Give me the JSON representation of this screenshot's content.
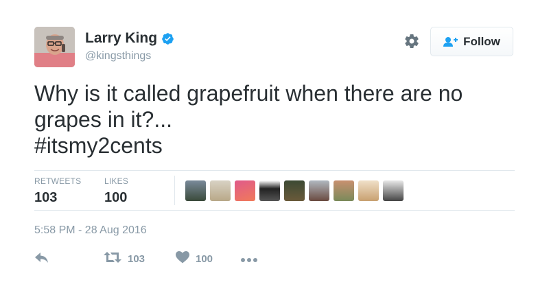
{
  "author": {
    "display_name": "Larry King",
    "handle": "@kingsthings",
    "verified": true
  },
  "follow_button": {
    "label": "Follow"
  },
  "tweet": {
    "text_line1": "Why is it called grapefruit when there are no",
    "text_line2": "grapes in it?...",
    "hashtag": "#itsmy2cents"
  },
  "stats": {
    "retweets_label": "RETWEETS",
    "retweets_value": "103",
    "likes_label": "LIKES",
    "likes_value": "100"
  },
  "likers_count_shown": 9,
  "timestamp": "5:58 PM - 28 Aug 2016",
  "actions": {
    "retweet_count": "103",
    "like_count": "100"
  },
  "colors": {
    "text": "#292f33",
    "muted": "#8899a6",
    "verified": "#1da1f2",
    "border": "#e1e8ed"
  },
  "icons": [
    "verified-badge-icon",
    "gear-icon",
    "add-user-icon",
    "reply-icon",
    "retweet-icon",
    "heart-icon",
    "more-icon"
  ]
}
